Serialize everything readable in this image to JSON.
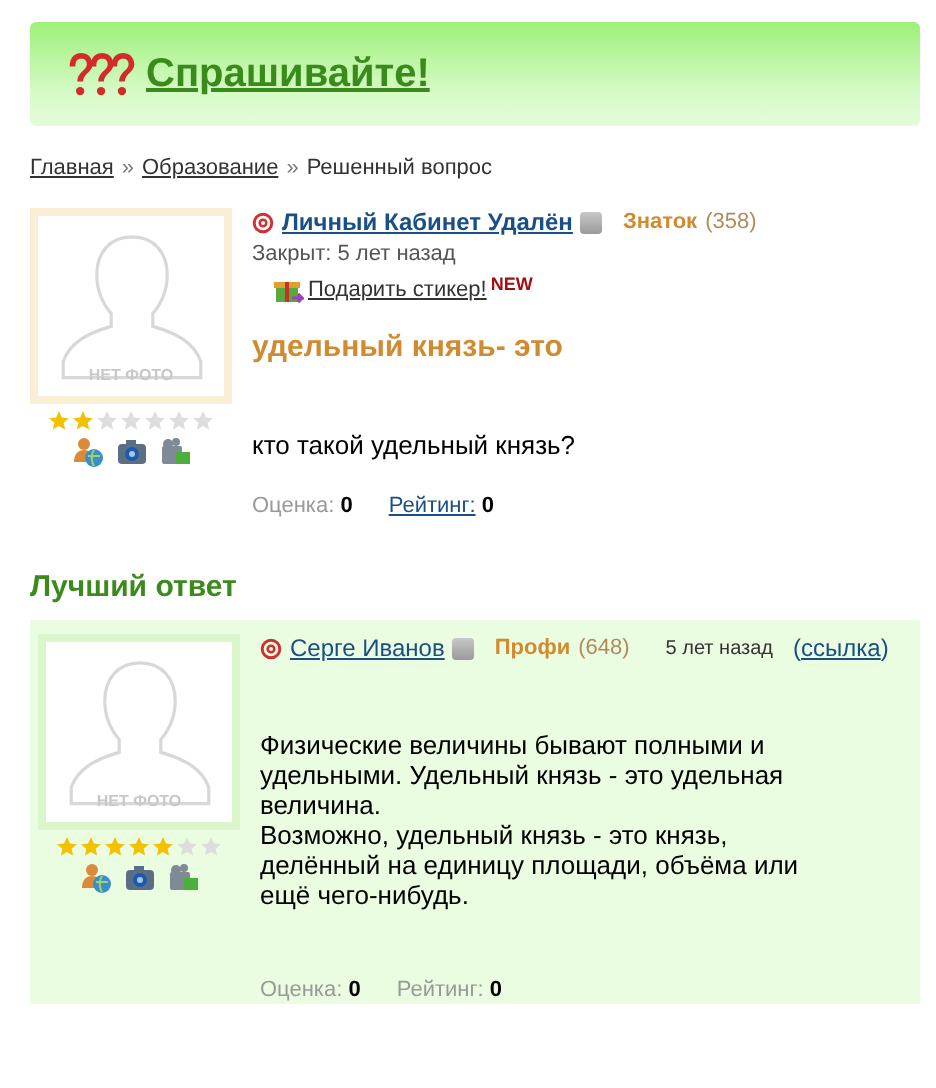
{
  "header": {
    "title": "Спрашивайте!"
  },
  "breadcrumbs": [
    {
      "label": "Главная",
      "kind": "link"
    },
    {
      "label": "»",
      "kind": "separator"
    },
    {
      "label": "Образование",
      "kind": "link"
    },
    {
      "label": "»",
      "kind": "separator"
    },
    {
      "label": "Решенный вопрос",
      "kind": "current"
    }
  ],
  "question": {
    "avatar_label": "НЕТ ФОТО",
    "stars": 2,
    "author": "Личный Кабинет Удалён",
    "rank": "Знаток",
    "score": "(358)",
    "closed": "Закрыт: 5 лет назад",
    "gift_link": "Подарить стикер!",
    "gift_badge": "NEW",
    "title": "удельный князь- это",
    "body": [
      "кто такой удельный князь?"
    ],
    "ratings": [
      {
        "label": "Оценка:",
        "value": "0",
        "link": false
      },
      {
        "label": "Рейтинг:",
        "value": "0",
        "link": true
      }
    ]
  },
  "best_answer": {
    "heading": "Лучший ответ",
    "avatar_label": "НЕТ ФОТО",
    "stars": 5,
    "author": "Серге Иванов",
    "rank": "Профи",
    "score": "(648)",
    "time": "5 лет назад",
    "permalink": {
      "open": "(",
      "label": "ссылка",
      "close": ")"
    },
    "body": [
      "Физические величины бывают полными и удельными. Удельный князь - это удельная величина.",
      "Возможно, удельный князь - это князь, делённый на единицу площади, объёма или ещё чего-нибудь."
    ],
    "ratings": [
      {
        "label": "Оценка:",
        "value": "0",
        "link": false
      },
      {
        "label": "Рейтинг:",
        "value": "0",
        "link": false
      }
    ]
  }
}
